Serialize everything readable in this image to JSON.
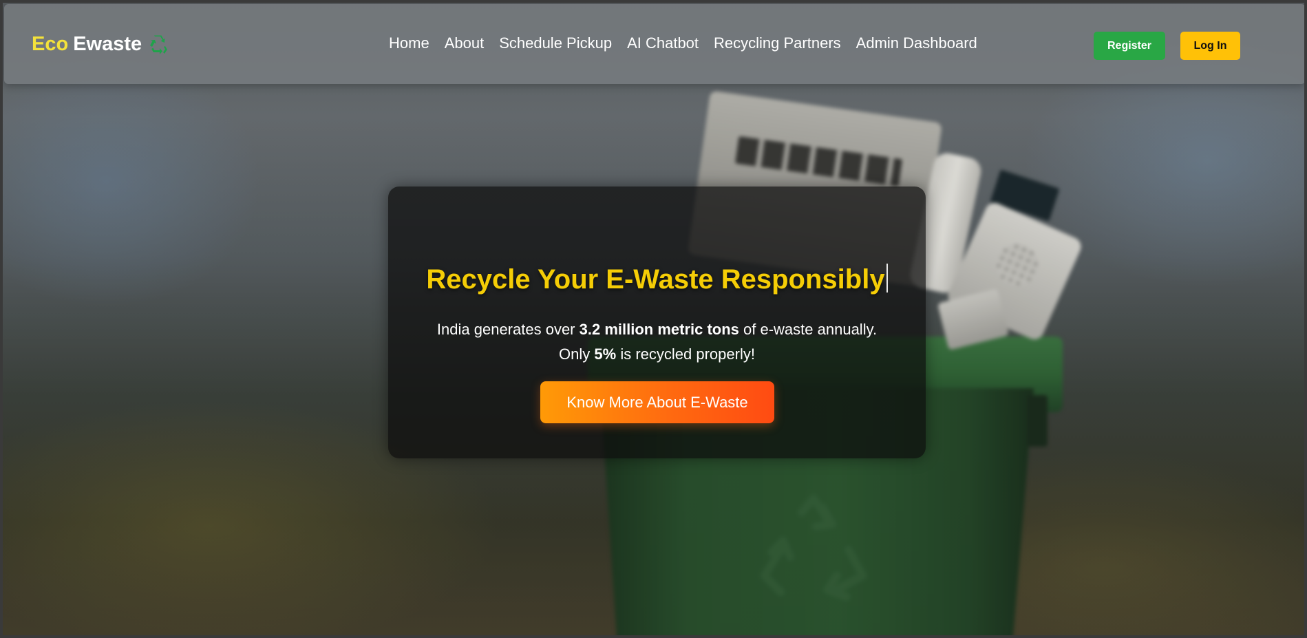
{
  "brand": {
    "eco": "Eco",
    "ewaste": "Ewaste",
    "icon": "recycle-icon"
  },
  "nav": {
    "links": [
      "Home",
      "About",
      "Schedule Pickup",
      "AI Chatbot",
      "Recycling Partners",
      "Admin Dashboard"
    ]
  },
  "auth": {
    "register_label": "Register",
    "login_label": "Log In"
  },
  "hero": {
    "title": "Recycle Your E-Waste Responsibly",
    "line1_pre": "India generates over ",
    "line1_bold": "3.2 million metric tons",
    "line1_post": " of e-waste annually.",
    "line2_pre": "Only ",
    "line2_bold": "5%",
    "line2_post": " is recycled properly!",
    "cta_label": "Know More About E-Waste"
  },
  "colors": {
    "eco_yellow": "#f4e23b",
    "title_gold": "#f5cd06",
    "register_green": "#29a745",
    "login_yellow": "#ffc107",
    "cta_orange": "#ff6a10"
  }
}
